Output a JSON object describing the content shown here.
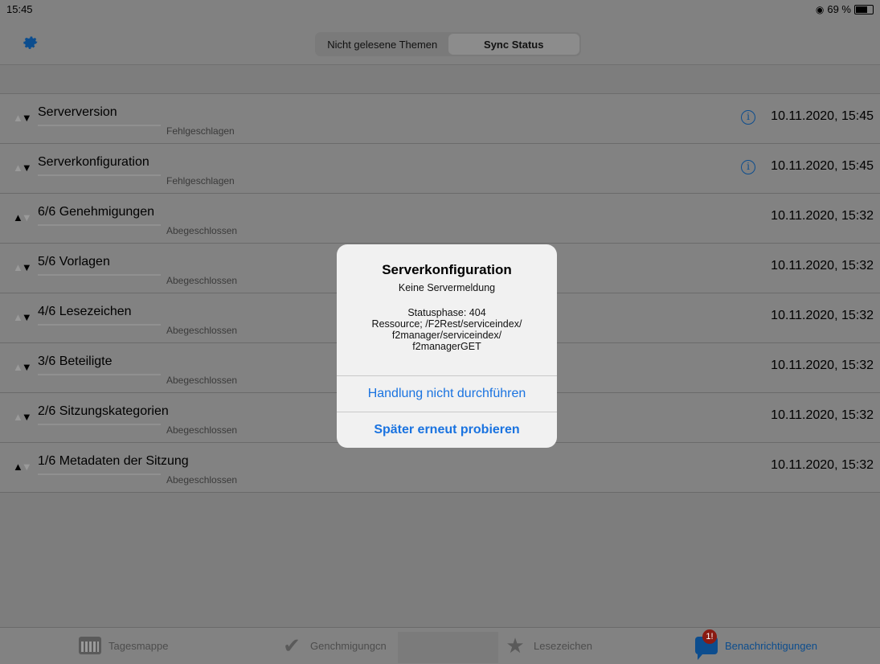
{
  "status_bar": {
    "time": "15:45",
    "battery": "69 %"
  },
  "header": {
    "segments": [
      "Nicht gelesene Themen",
      "Sync Status"
    ],
    "active_segment": "Sync Status"
  },
  "rows": [
    {
      "title": "Serverversion",
      "status": "Fehlgeschlagen",
      "date": "10.11.2020, 15:45",
      "progress": 0,
      "info": true
    },
    {
      "title": "Serverkonfiguration",
      "status": "Fehlgeschlagen",
      "date": "10.11.2020, 15:45",
      "progress": 0,
      "info": true
    },
    {
      "title": "6/6 Genehmigungen",
      "status": "Abegeschlossen",
      "date": "10.11.2020, 15:32",
      "progress": 1,
      "info": false
    },
    {
      "title": "5/6 Vorlagen",
      "status": "Abegeschlossen",
      "date": "10.11.2020, 15:32",
      "progress": 1,
      "info": false
    },
    {
      "title": "4/6 Lesezeichen",
      "status": "Abegeschlossen",
      "date": "10.11.2020, 15:32",
      "progress": 1,
      "info": false
    },
    {
      "title": "3/6 Beteiligte",
      "status": "Abegeschlossen",
      "date": "10.11.2020, 15:32",
      "progress": 1,
      "info": false
    },
    {
      "title": "2/6 Sitzungskategorien",
      "status": "Abegeschlossen",
      "date": "10.11.2020, 15:32",
      "progress": 1,
      "info": false
    },
    {
      "title": "1/6 Metadaten der Sitzung",
      "status": "Abegeschlossen",
      "date": "10.11.2020, 15:32",
      "progress": 1,
      "info": false
    }
  ],
  "alert": {
    "title": "Serverkonfiguration",
    "message": "Keine Servermeldung",
    "detail": "Statusphase: 404\nRessource; /F2Rest/serviceindex/\nf2manager/serviceindex/\nf2managerGET",
    "button_cancel": "Handlung nicht durchführen",
    "button_retry": "Später erneut probieren"
  },
  "tabbar": {
    "tagesmappe": "Tagesmappe",
    "genehmigungen": "Genchmigungcn",
    "lesezeichen": "Lesezeichen",
    "benachrichtigungen": "Benachrichtigungen",
    "badge": "1!"
  },
  "colors": {
    "accent": "#1a73e0",
    "dim_accent": "#0c4d8e",
    "badge": "#8a1a12"
  }
}
